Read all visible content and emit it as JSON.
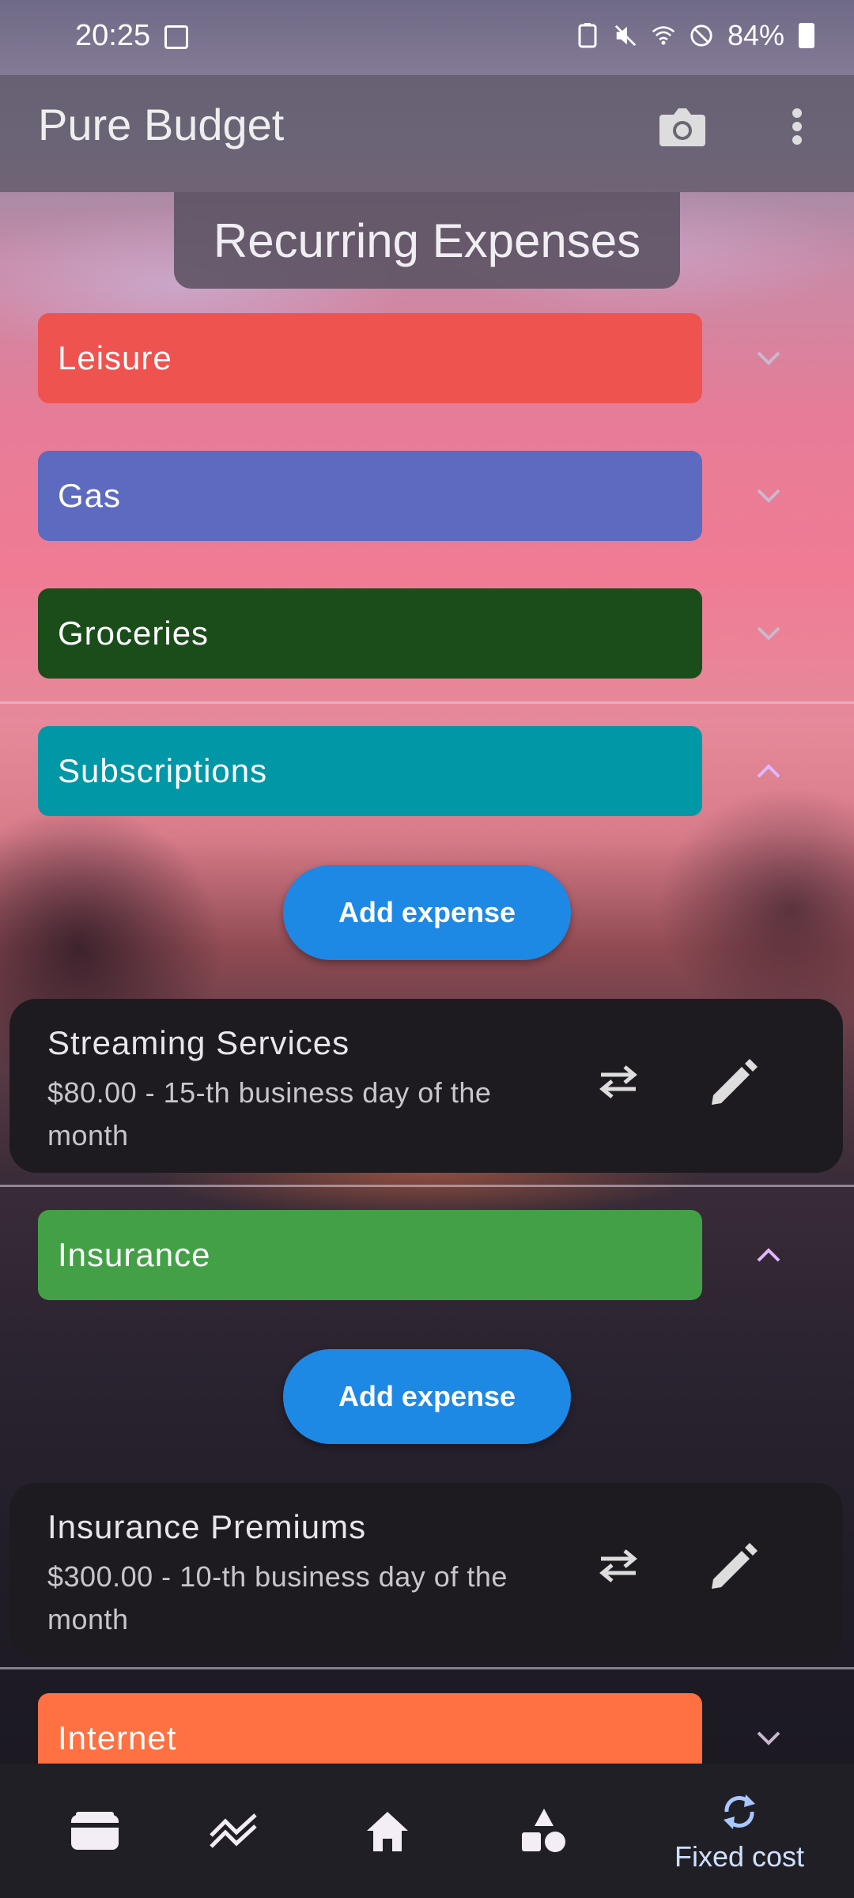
{
  "status_bar": {
    "time": "20:25",
    "battery": "84%"
  },
  "app_bar": {
    "title": "Pure Budget"
  },
  "section_title": "Recurring Expenses",
  "categories": [
    {
      "name": "Leisure",
      "color": "#ef5350",
      "expanded": false
    },
    {
      "name": "Gas",
      "color": "#5c6bc0",
      "expanded": false
    },
    {
      "name": "Groceries",
      "color": "#1b4d1b",
      "expanded": false
    },
    {
      "name": "Subscriptions",
      "color": "#0097a7",
      "expanded": true,
      "add_label": "Add expense",
      "expenses": [
        {
          "name": "Streaming Services",
          "detail": "$80.00 - 15-th business day of the month"
        }
      ]
    },
    {
      "name": "Insurance",
      "color": "#43a047",
      "expanded": true,
      "add_label": "Add expense",
      "expenses": [
        {
          "name": "Insurance Premiums",
          "detail": "$300.00 - 10-th business day of the month"
        }
      ]
    },
    {
      "name": "Internet",
      "color": "#ff7043",
      "expanded": false
    }
  ],
  "bottom_nav": {
    "items": [
      {
        "icon": "wallet-icon"
      },
      {
        "icon": "trend-icon"
      },
      {
        "icon": "home-icon"
      },
      {
        "icon": "shapes-icon"
      },
      {
        "icon": "recurring-icon",
        "label": "Fixed cost",
        "selected": true
      }
    ]
  },
  "colors": {
    "accent": "#1e88e5",
    "chevron_expanded": "#e0b8ff"
  }
}
